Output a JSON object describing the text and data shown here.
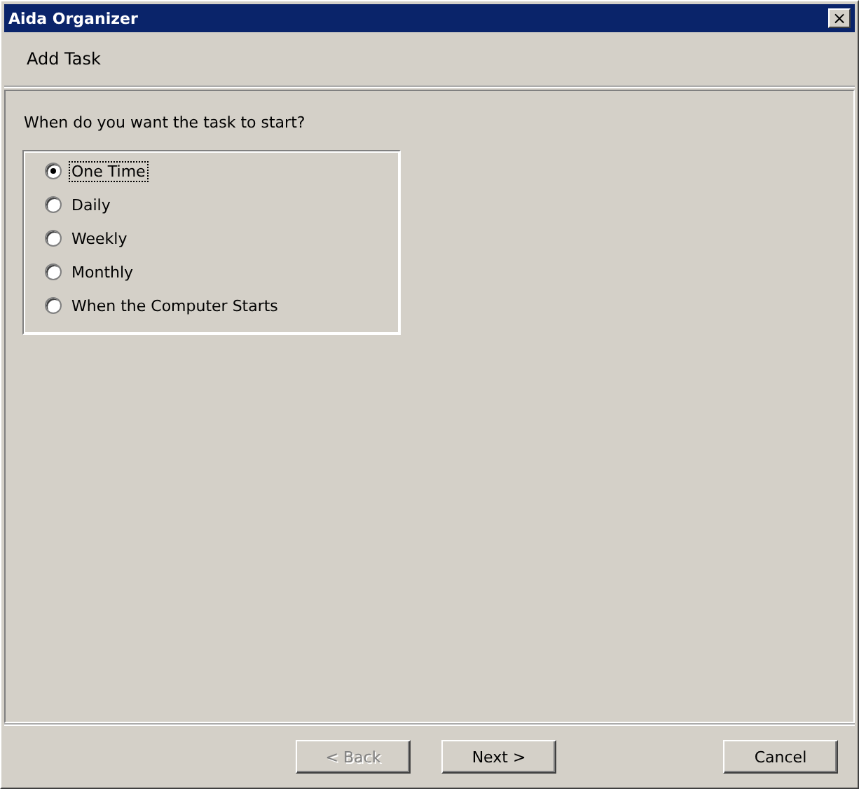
{
  "window": {
    "title": "Aida Organizer",
    "close": "×"
  },
  "header": {
    "title": "Add Task"
  },
  "question": "When do you want the task to start?",
  "options": [
    {
      "label": "One Time",
      "selected": true
    },
    {
      "label": "Daily",
      "selected": false
    },
    {
      "label": "Weekly",
      "selected": false
    },
    {
      "label": "Monthly",
      "selected": false
    },
    {
      "label": "When the Computer Starts",
      "selected": false
    }
  ],
  "buttons": [
    {
      "label": "< Back",
      "disabled": true,
      "kind": "nav"
    },
    {
      "label": "Next >",
      "disabled": false,
      "kind": "nav"
    },
    {
      "label": "Cancel",
      "disabled": false,
      "kind": "cancel"
    }
  ]
}
